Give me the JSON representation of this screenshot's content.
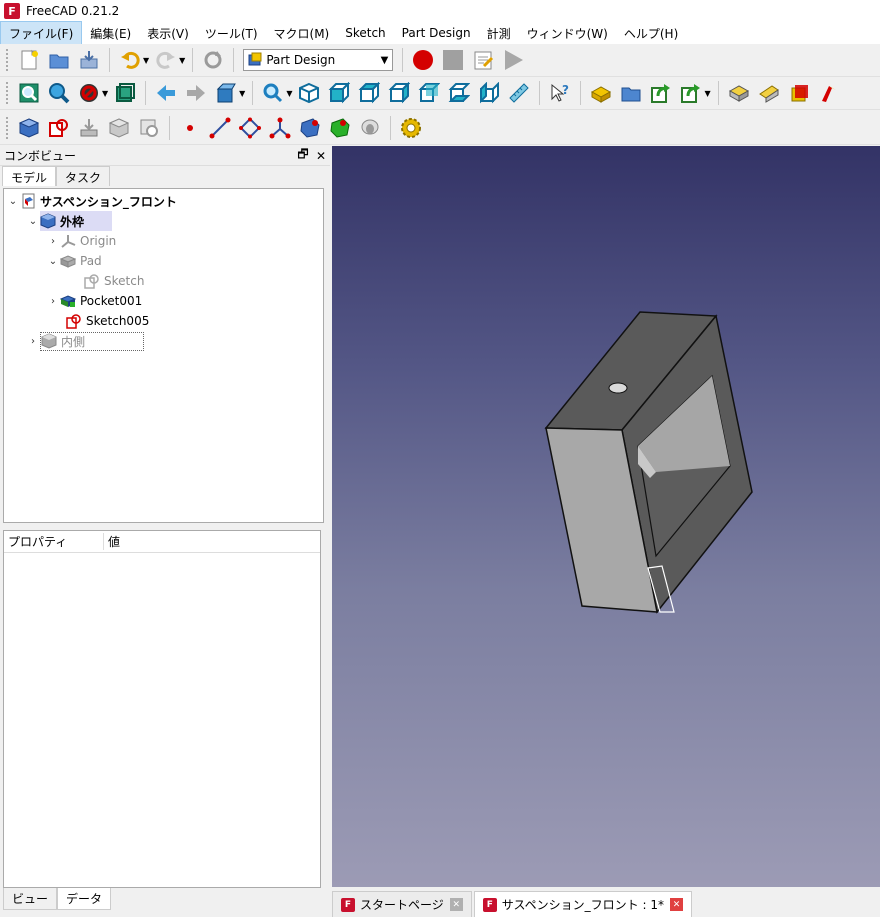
{
  "window": {
    "title": "FreeCAD 0.21.2",
    "app_icon": "freecad-icon"
  },
  "menu": [
    "ファイル(F)",
    "編集(E)",
    "表示(V)",
    "ツール(T)",
    "マクロ(M)",
    "Sketch",
    "Part Design",
    "計測",
    "ウィンドウ(W)",
    "ヘルプ(H)"
  ],
  "toolbar": {
    "workbench": "Part Design"
  },
  "combo": {
    "title": "コンボビュー",
    "tabs": [
      "モデル",
      "タスク"
    ],
    "tree": [
      {
        "label": "サスペンション_フロント",
        "icon": "document-icon"
      },
      {
        "label": "外枠",
        "icon": "body-icon"
      },
      {
        "label": "Origin",
        "icon": "origin-icon"
      },
      {
        "label": "Pad",
        "icon": "pad-icon"
      },
      {
        "label": "Sketch",
        "icon": "sketch-icon"
      },
      {
        "label": "Pocket001",
        "icon": "pocket-icon"
      },
      {
        "label": "Sketch005",
        "icon": "sketch-icon"
      },
      {
        "label": "内側",
        "icon": "body-icon"
      }
    ],
    "properties": {
      "col_property": "プロパティ",
      "col_value": "値"
    },
    "bottom_tabs": [
      "ビュー",
      "データ"
    ]
  },
  "doc_tabs": [
    {
      "label": "スタートページ"
    },
    {
      "label": "サスペンション_フロント : 1*"
    }
  ],
  "colors": {
    "selection": "#dcdcf5",
    "viewport_top": "#333366",
    "viewport_bottom": "#9c9bb5",
    "record": "#d40000",
    "close": "#e04040"
  }
}
